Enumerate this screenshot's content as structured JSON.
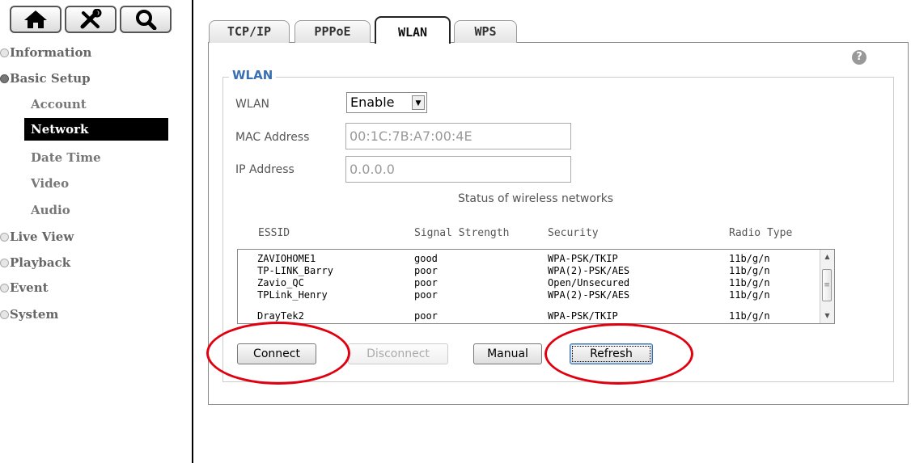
{
  "toolbar": {
    "home_icon": "home-icon",
    "tools_icon": "tools-icon",
    "search_icon": "search-icon"
  },
  "nav": {
    "information": "Information",
    "basic_setup": "Basic Setup",
    "sub": [
      "Account",
      "Network",
      "Date Time",
      "Video",
      "Audio"
    ],
    "live_view": "Live View",
    "playback": "Playback",
    "event": "Event",
    "system": "System"
  },
  "tabs": [
    "TCP/IP",
    "PPPoE",
    "WLAN",
    "WPS"
  ],
  "active_tab": "WLAN",
  "wlan": {
    "legend": "WLAN",
    "wlan_label": "WLAN",
    "wlan_value": "Enable",
    "mac_label": "MAC Address",
    "mac_value": "00:1C:7B:A7:00:4E",
    "ip_label": "IP Address",
    "ip_value": "0.0.0.0",
    "status_title": "Status of wireless networks",
    "columns": [
      "ESSID",
      "Signal Strength",
      "Security",
      "Radio Type"
    ],
    "networks": [
      {
        "essid": "ZAVIOHOME1",
        "signal": "good",
        "security": "WPA-PSK/TKIP",
        "radio": "11b/g/n"
      },
      {
        "essid": "TP-LINK_Barry",
        "signal": "poor",
        "security": "WPA(2)-PSK/AES",
        "radio": "11b/g/n"
      },
      {
        "essid": "Zavio_QC",
        "signal": "poor",
        "security": "Open/Unsecured",
        "radio": "11b/g/n"
      },
      {
        "essid": "TPLink_Henry",
        "signal": "poor",
        "security": "WPA(2)-PSK/AES",
        "radio": "11b/g/n"
      },
      {
        "essid": "DrayTek2",
        "signal": "poor",
        "security": "WPA-PSK/TKIP",
        "radio": "11b/g/n"
      }
    ]
  },
  "buttons": {
    "connect": "Connect",
    "disconnect": "Disconnect",
    "manual": "Manual",
    "refresh": "Refresh"
  },
  "colors": {
    "accent": "#3a70b0",
    "annotation": "#e00010"
  }
}
